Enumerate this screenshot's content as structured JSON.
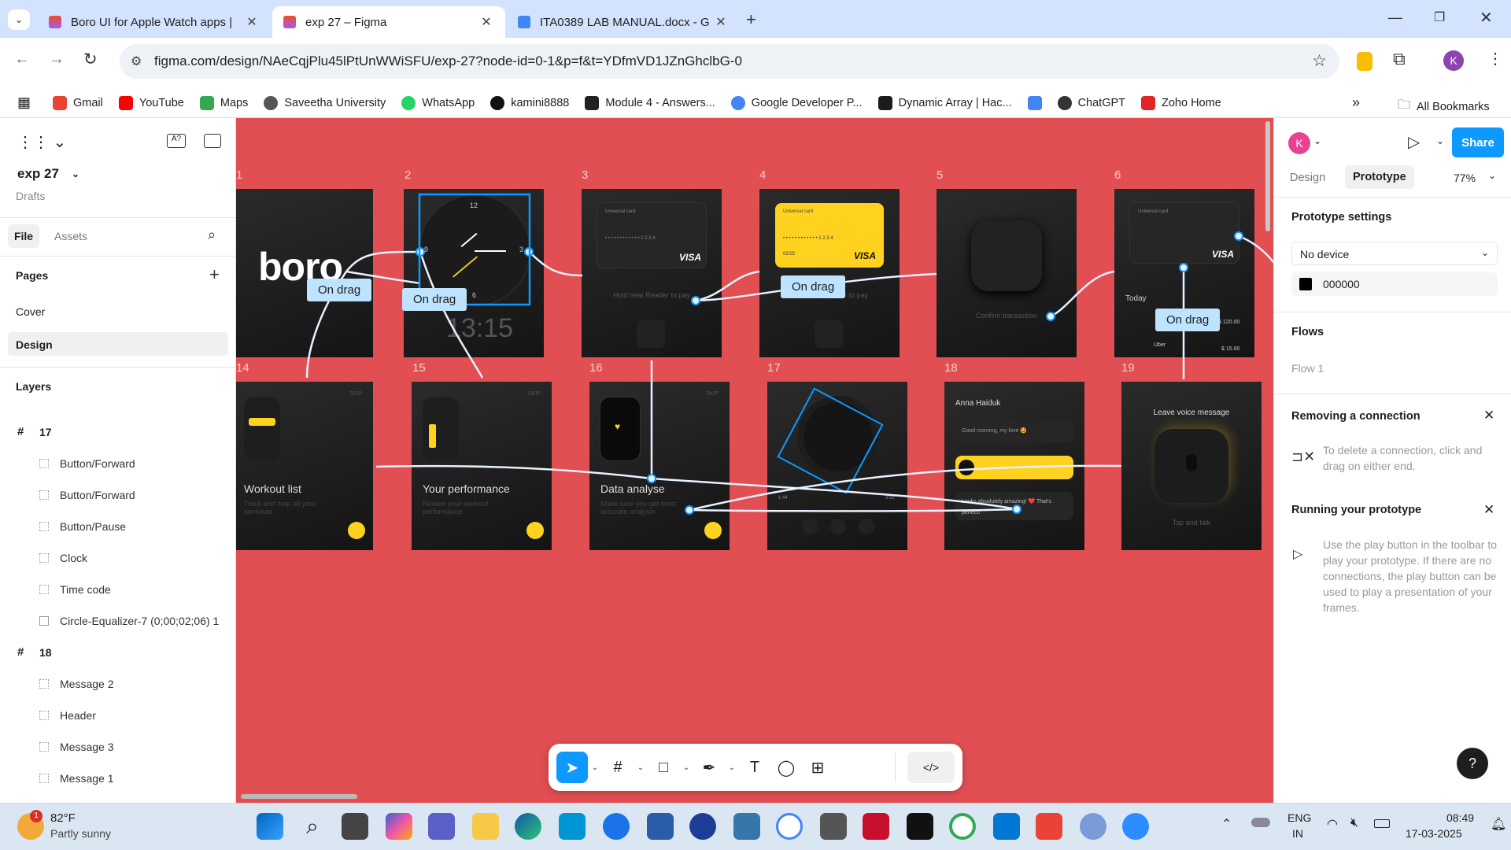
{
  "browser": {
    "tabs": [
      {
        "title": "Boro UI for Apple Watch apps |",
        "active": false
      },
      {
        "title": "exp 27 – Figma",
        "active": true
      },
      {
        "title": "ITA0389 LAB MANUAL.docx - G",
        "active": false
      }
    ],
    "new_tab": "+",
    "url": "figma.com/design/NAeCqjPlu45lPtUnWWiSFU/exp-27?node-id=0-1&p=f&t=YDfmVD1JZnGhclbG-0",
    "profile_initial": "K",
    "bookmarks": [
      "Gmail",
      "YouTube",
      "Maps",
      "Saveetha University",
      "WhatsApp",
      "kamini8888",
      "Module 4 - Answers...",
      "Google Developer P...",
      "Dynamic Array | Hac...",
      "ChatGPT",
      "Zoho Home"
    ],
    "all_bookmarks": "All Bookmarks",
    "more_bookmarks": "»"
  },
  "left_panel": {
    "file_name": "exp 27",
    "location": "Drafts",
    "tabs": {
      "file": "File",
      "assets": "Assets"
    },
    "pages_title": "Pages",
    "pages": [
      "Cover",
      "Design"
    ],
    "selected_page": "Design",
    "layers_title": "Layers",
    "layer_groups": [
      {
        "name": "17",
        "children": [
          "Button/Forward",
          "Button/Forward",
          "Button/Pause",
          "Clock",
          "Time code",
          "Circle-Equalizer-7 (0;00;02;06) 1"
        ]
      },
      {
        "name": "18",
        "children": [
          "Message 2",
          "Header",
          "Message 3",
          "Message 1"
        ]
      }
    ]
  },
  "canvas": {
    "frame_numbers": [
      "1",
      "2",
      "3",
      "4",
      "5",
      "6",
      "14",
      "15",
      "16",
      "17",
      "18",
      "19"
    ],
    "connection_label": "On drag",
    "frames": {
      "f1": {
        "logo": "boro"
      },
      "f2": {
        "clock_12": "12",
        "clock_3": "3",
        "clock_6": "6",
        "clock_9": "9",
        "time": "13:15"
      },
      "f3": {
        "card_label": "Universal card",
        "card_number": "• • • •   • • • •   • • • •   1 2 3 4",
        "brand": "VISA",
        "hint": "Hold near Reader to pay"
      },
      "f4": {
        "card_label": "Universal card",
        "card_number": "• • • •   • • • •   • • • •   1 2 3 4",
        "brand": "VISA",
        "expiry": "02/25",
        "hint": "Hold near Reader to pay"
      },
      "f5": {
        "hint": "Confirm transaction"
      },
      "f6": {
        "card_label": "Universal card",
        "brand": "VISA",
        "today": "Today",
        "amount1": "$ 120.00",
        "merchant": "Uber",
        "amount2": "$ 15.00"
      },
      "f14": {
        "skip": "SKIP",
        "title": "Workout list",
        "desc": "Track and map all your workouts"
      },
      "f15": {
        "skip": "SKIP",
        "title": "Your performance",
        "desc": "Review your workout performance"
      },
      "f16": {
        "skip": "SKIP",
        "title": "Data analyse",
        "desc": "Make sure you get most accurate analysis"
      },
      "f17": {
        "time_start": "1:44",
        "time_end": "3:02"
      },
      "f18": {
        "name": "Anna Haiduk",
        "msg1": "Good morning, my love 🤩",
        "msg2": "Looks absolutely amazing! ❤️ That's perfect!"
      },
      "f19": {
        "title": "Leave voice message",
        "hint": "Tap and talk"
      }
    }
  },
  "right_panel": {
    "avatar": "K",
    "share": "Share",
    "tabs": {
      "design": "Design",
      "prototype": "Prototype"
    },
    "active_tab": "Prototype",
    "zoom": "77%",
    "prototype_settings": "Prototype settings",
    "device": "No device",
    "bg_color": "000000",
    "flows_title": "Flows",
    "flow": "Flow 1",
    "removing_title": "Removing a connection",
    "removing_text": "To delete a connection, click and drag on either end.",
    "running_title": "Running your prototype",
    "running_text": "Use the play button in the toolbar to play your prototype. If there are no connections, the play button can be used to play a presentation of your frames.",
    "help": "?"
  },
  "taskbar": {
    "weather_temp": "82°F",
    "weather_desc": "Partly sunny",
    "weather_badge": "1",
    "lang1": "ENG",
    "lang2": "IN",
    "time": "08:49",
    "date": "17-03-2025"
  },
  "colors": {
    "canvas": "#e24f52",
    "accent": "#0d99ff",
    "yellow": "#ffd21f",
    "bubble": "#bde3ff"
  }
}
